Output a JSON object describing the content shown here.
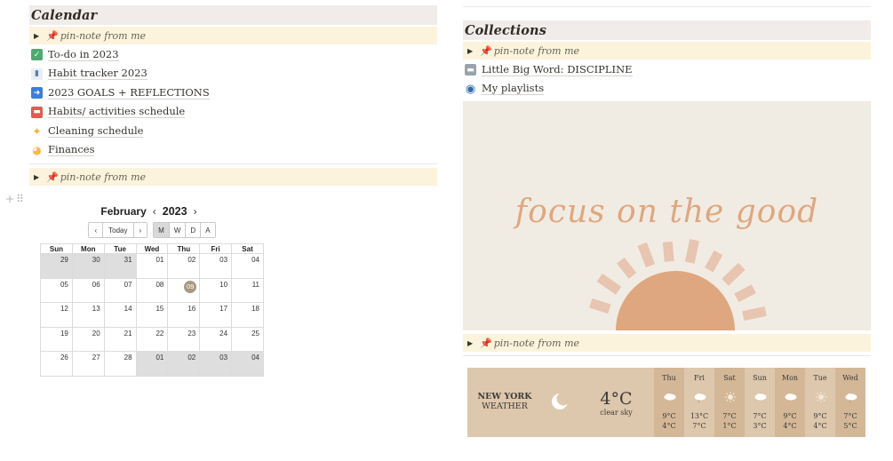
{
  "left": {
    "heading": "Calendar",
    "pin_note_label": "pin-note from me",
    "links": [
      {
        "icon": "check-icon",
        "label": "To-do in 2023",
        "color": "#4dab6f",
        "glyph": "✓"
      },
      {
        "icon": "bar-chart-icon",
        "label": "Habit tracker 2023",
        "color": "#e9eef3",
        "glyph": "▮"
      },
      {
        "icon": "arrow-right-icon",
        "label": "2023 GOALS + REFLECTIONS",
        "color": "#3b7ddd",
        "glyph": "➜"
      },
      {
        "icon": "calendar-icon",
        "label": "Habits/ activities schedule",
        "color": "#e35a4f",
        "glyph": "▬"
      },
      {
        "icon": "sparkles-icon",
        "label": "Cleaning schedule",
        "color": "#f2b632",
        "glyph": "✦"
      },
      {
        "icon": "face-icon",
        "label": "Finances",
        "color": "#f5b942",
        "glyph": "◕"
      }
    ],
    "pin_note_label_2": "pin-note from me"
  },
  "calendar": {
    "month": "February",
    "year": "2023",
    "prev": "‹",
    "next": "›",
    "today_label": "Today",
    "views": [
      "M",
      "W",
      "D",
      "A"
    ],
    "active_view": "M",
    "weekdays": [
      "Sun",
      "Mon",
      "Tue",
      "Wed",
      "Thu",
      "Fri",
      "Sat"
    ],
    "weeks": [
      [
        {
          "d": "29",
          "o": true
        },
        {
          "d": "30",
          "o": true
        },
        {
          "d": "31",
          "o": true
        },
        {
          "d": "01"
        },
        {
          "d": "02"
        },
        {
          "d": "03"
        },
        {
          "d": "04"
        }
      ],
      [
        {
          "d": "05"
        },
        {
          "d": "06"
        },
        {
          "d": "07"
        },
        {
          "d": "08"
        },
        {
          "d": "09",
          "today": true
        },
        {
          "d": "10"
        },
        {
          "d": "11"
        }
      ],
      [
        {
          "d": "12"
        },
        {
          "d": "13"
        },
        {
          "d": "14"
        },
        {
          "d": "15"
        },
        {
          "d": "16"
        },
        {
          "d": "17"
        },
        {
          "d": "18"
        }
      ],
      [
        {
          "d": "19"
        },
        {
          "d": "20"
        },
        {
          "d": "21"
        },
        {
          "d": "22"
        },
        {
          "d": "23"
        },
        {
          "d": "24"
        },
        {
          "d": "25"
        }
      ],
      [
        {
          "d": "26"
        },
        {
          "d": "27"
        },
        {
          "d": "28"
        },
        {
          "d": "01",
          "o": true
        },
        {
          "d": "02",
          "o": true
        },
        {
          "d": "03",
          "o": true
        },
        {
          "d": "04",
          "o": true
        }
      ]
    ]
  },
  "right": {
    "heading": "Collections",
    "pin_note_label": "pin-note from me",
    "links": [
      {
        "icon": "page-icon",
        "label": "Little Big Word: DISCIPLINE",
        "color": "#9aa3ad",
        "glyph": "▬"
      },
      {
        "icon": "record-icon",
        "label": "My playlists",
        "color": "#2e6ca3",
        "glyph": "◉"
      }
    ],
    "banner_text": "focus on the good",
    "banner_color": "#dfa77f",
    "pin_note_label_2": "pin-note from me"
  },
  "weather": {
    "city_line1": "NEW YORK",
    "city_line2": "WEATHER",
    "current_icon": "moon-icon",
    "temp": "4°C",
    "desc": "clear sky",
    "days": [
      {
        "name": "Thu",
        "icon": "cloud-icon",
        "hi": "9°C",
        "lo": "4°C"
      },
      {
        "name": "Fri",
        "icon": "rain-cloud-icon",
        "hi": "13°C",
        "lo": "7°C"
      },
      {
        "name": "Sat",
        "icon": "sun-icon",
        "hi": "7°C",
        "lo": "1°C"
      },
      {
        "name": "Sun",
        "icon": "cloud-icon",
        "hi": "7°C",
        "lo": "3°C"
      },
      {
        "name": "Mon",
        "icon": "cloud-icon",
        "hi": "9°C",
        "lo": "4°C"
      },
      {
        "name": "Tue",
        "icon": "sun-icon",
        "hi": "9°C",
        "lo": "4°C"
      },
      {
        "name": "Wed",
        "icon": "rain-cloud-icon",
        "hi": "7°C",
        "lo": "5°C"
      }
    ]
  }
}
